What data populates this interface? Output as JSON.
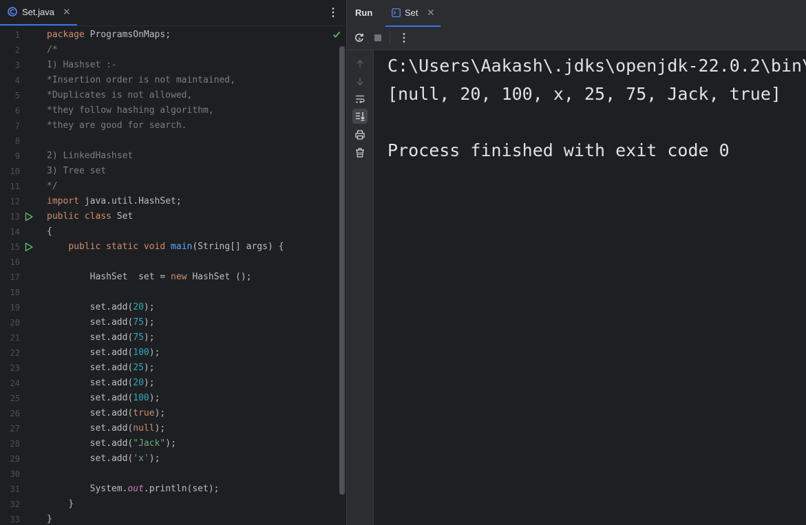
{
  "editor": {
    "tab": {
      "label": "Set.java",
      "close": "✕"
    },
    "menu": "⋮",
    "lines": [
      {
        "n": "1",
        "code": "package ProgramsOnMaps;"
      },
      {
        "n": "2",
        "code": "/*"
      },
      {
        "n": "3",
        "code": "1) Hashset :-"
      },
      {
        "n": "4",
        "code": "*Insertion order is not maintained,"
      },
      {
        "n": "5",
        "code": "*Duplicates is not allowed,"
      },
      {
        "n": "6",
        "code": "*they follow hashing algorithm,"
      },
      {
        "n": "7",
        "code": "*they are good for search."
      },
      {
        "n": "8",
        "code": ""
      },
      {
        "n": "9",
        "code": "2) LinkedHashset"
      },
      {
        "n": "10",
        "code": "3) Tree set"
      },
      {
        "n": "11",
        "code": "*/"
      },
      {
        "n": "12",
        "code": "import java.util.HashSet;"
      },
      {
        "n": "13",
        "code": "public class Set"
      },
      {
        "n": "14",
        "code": "{"
      },
      {
        "n": "15",
        "code": "    public static void main(String[] args) {"
      },
      {
        "n": "16",
        "code": ""
      },
      {
        "n": "17",
        "code": "        HashSet  set = new HashSet ();"
      },
      {
        "n": "18",
        "code": ""
      },
      {
        "n": "19",
        "code": "        set.add(20);"
      },
      {
        "n": "20",
        "code": "        set.add(75);"
      },
      {
        "n": "21",
        "code": "        set.add(75);"
      },
      {
        "n": "22",
        "code": "        set.add(100);"
      },
      {
        "n": "23",
        "code": "        set.add(25);"
      },
      {
        "n": "24",
        "code": "        set.add(20);"
      },
      {
        "n": "25",
        "code": "        set.add(100);"
      },
      {
        "n": "26",
        "code": "        set.add(true);"
      },
      {
        "n": "27",
        "code": "        set.add(null);"
      },
      {
        "n": "28",
        "code": "        set.add(\"Jack\");"
      },
      {
        "n": "29",
        "code": "        set.add('x');"
      },
      {
        "n": "30",
        "code": ""
      },
      {
        "n": "31",
        "code": "        System.out.println(set);"
      },
      {
        "n": "32",
        "code": "    }"
      },
      {
        "n": "33",
        "code": "}"
      }
    ],
    "run_gutter_lines": [
      "13",
      "15"
    ]
  },
  "run": {
    "title": "Run",
    "tab": {
      "label": "Set",
      "close": "✕"
    },
    "menu": "⋮",
    "console": [
      "C:\\Users\\Aakash\\.jdks\\openjdk-22.0.2\\bin\\",
      "[null, 20, 100, x, 25, 75, Jack, true]",
      "",
      "Process finished with exit code 0"
    ]
  },
  "colors": {
    "keyword": "#cf8e6d",
    "comment": "#7a7e85",
    "number": "#2aacb8",
    "string": "#6aab73",
    "method": "#56a8f5",
    "static_field": "#c77dbb",
    "run_icon": "#5fb865",
    "accent": "#3574f0"
  },
  "icons": {
    "file_tab": "java-class-icon",
    "inspection": "checkmark-icon",
    "rerun": "rerun-icon",
    "stop": "stop-icon",
    "side": [
      "arrow-up-icon",
      "arrow-down-icon",
      "soft-wrap-icon",
      "scroll-to-end-icon",
      "print-icon",
      "trash-icon"
    ]
  }
}
